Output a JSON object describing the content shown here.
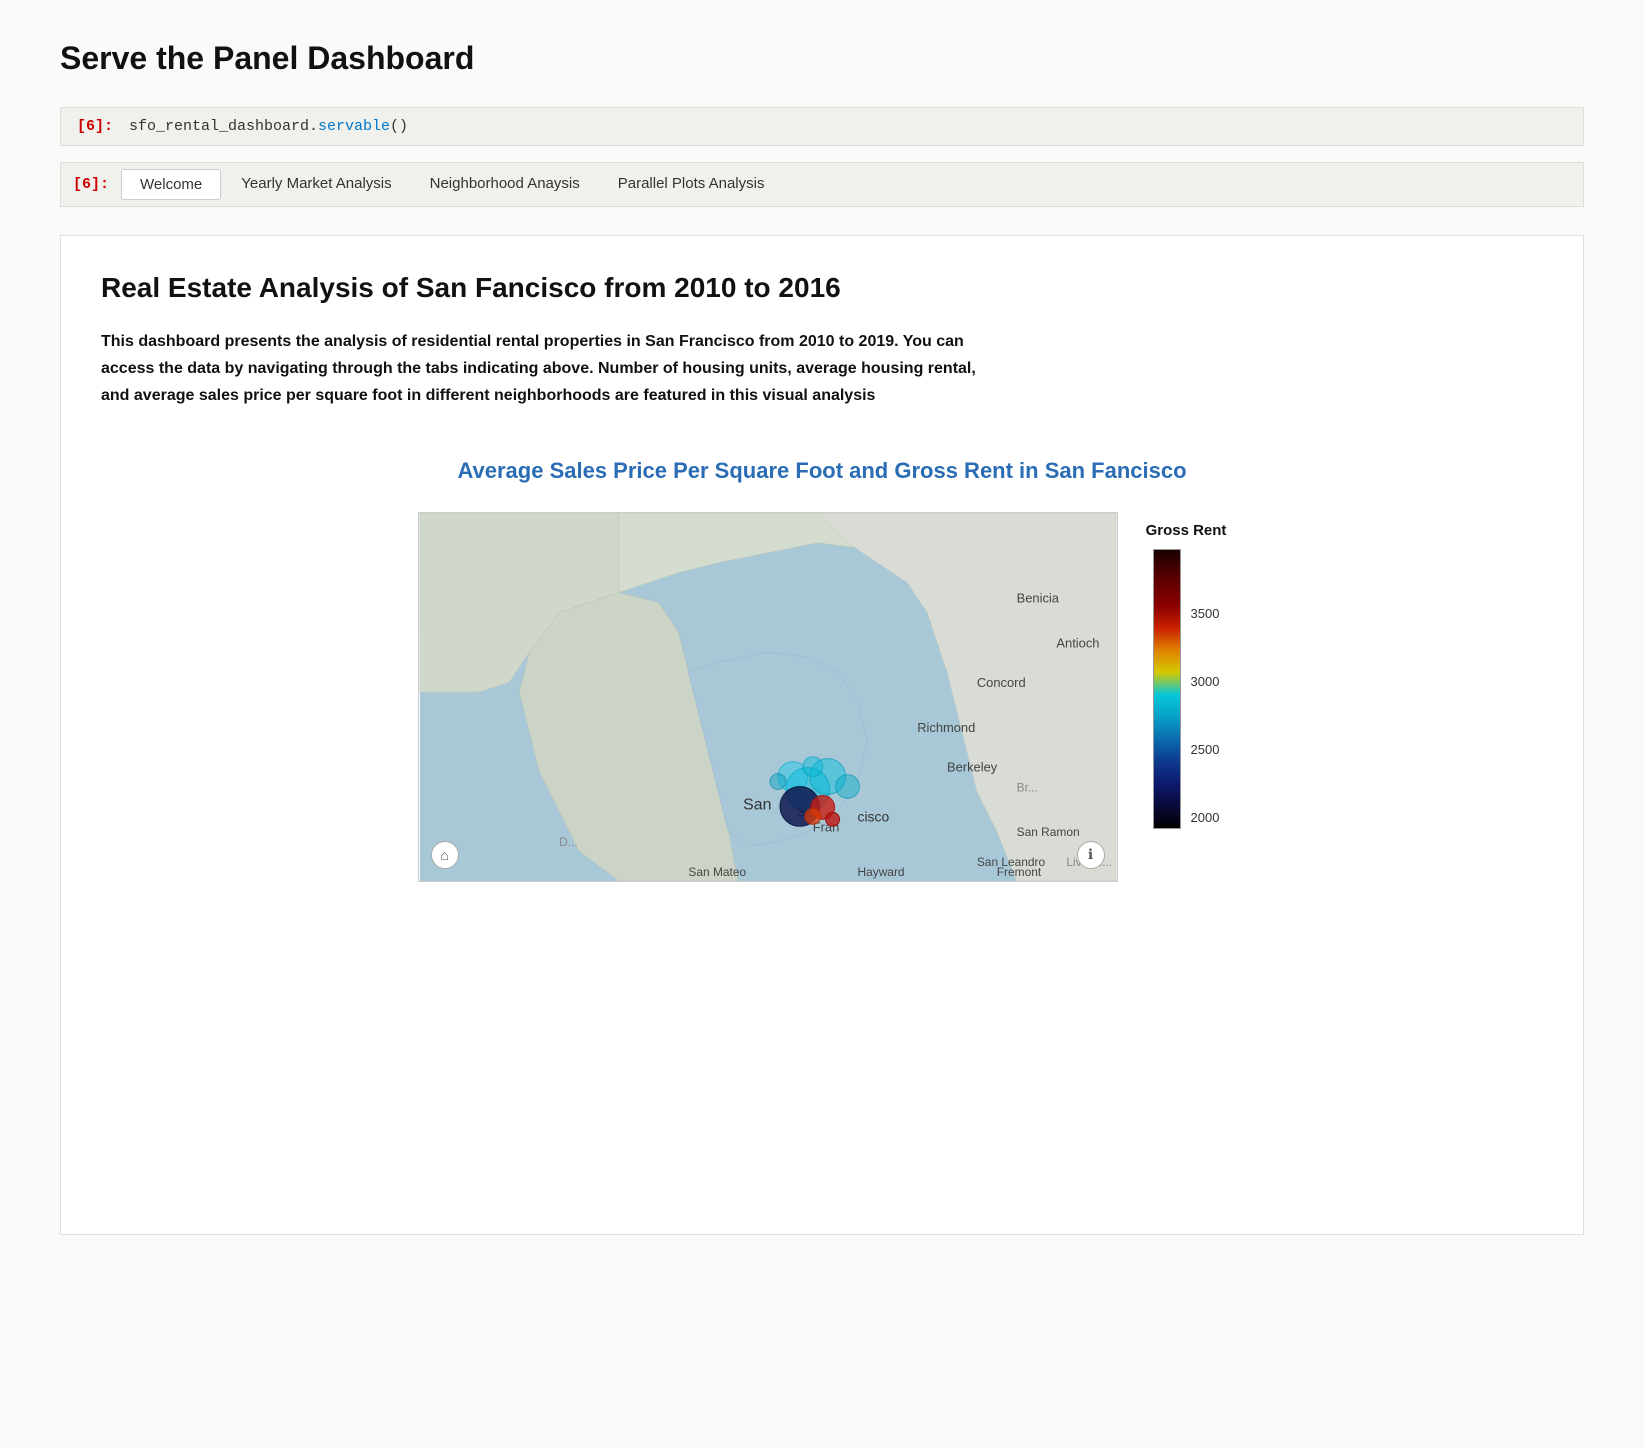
{
  "page": {
    "title": "Serve the Panel Dashboard"
  },
  "code_cell": {
    "label": "[6]:",
    "code_plain": "sfo_rental_dashboard.",
    "code_highlight": "servable",
    "code_suffix": "()"
  },
  "tabs": {
    "label": "[6]:",
    "items": [
      {
        "label": "Welcome",
        "active": true
      },
      {
        "label": "Yearly Market Analysis",
        "active": false
      },
      {
        "label": "Neighborhood Anaysis",
        "active": false
      },
      {
        "label": "Parallel Plots Analysis",
        "active": false
      }
    ]
  },
  "welcome": {
    "main_heading": "Real Estate Analysis of San Fancisco from 2010 to 2016",
    "description": "This dashboard presents the analysis of residential rental properties in San Francisco from 2010 to 2019. You can access the data by navigating through the tabs indicating above. Number of housing units, average housing rental, and average sales price per square foot in different neighborhoods are featured in this visual analysis",
    "map_section_title": "Average Sales Price Per Square Foot and Gross Rent in San Fancisco",
    "legend": {
      "title": "Gross Rent",
      "values": [
        "3500",
        "3000",
        "2500",
        "2000"
      ]
    },
    "map_buttons": {
      "home": "⌂",
      "info": "ℹ"
    }
  }
}
